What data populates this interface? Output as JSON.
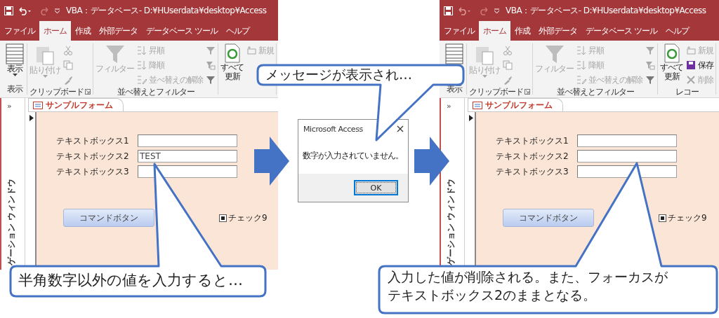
{
  "left_screen": {
    "title": "VBA：データベース- D:¥HUserdata¥desktop¥Access",
    "undo": {
      "disabled": false
    },
    "ribbon_tabs": [
      {
        "label": "ファイル",
        "selected": false
      },
      {
        "label": "ホーム",
        "selected": true
      },
      {
        "label": "作成",
        "selected": false
      },
      {
        "label": "外部データ",
        "selected": false
      },
      {
        "label": "データベース ツール",
        "selected": false
      },
      {
        "label": "ヘルプ",
        "selected": false
      }
    ],
    "ribbon_groups": [
      {
        "kind": "view",
        "label": "表示",
        "items": [
          {
            "label": "表示",
            "disabled": false
          }
        ]
      },
      {
        "kind": "clipboard",
        "label": "クリップボード",
        "items": [
          {
            "label": "貼り付け",
            "disabled": true
          }
        ]
      },
      {
        "kind": "sort",
        "label": "並べ替えとフィルター",
        "items": [
          {
            "label": "フィルター",
            "disabled": true
          },
          {
            "label": "昇順",
            "disabled": true
          },
          {
            "label": "降順",
            "disabled": true
          },
          {
            "label": "並べ替えの解除",
            "disabled": true
          }
        ]
      },
      {
        "kind": "records",
        "items": [
          {
            "lines": [
              "すべて",
              "更新"
            ],
            "disabled": false
          },
          {
            "label": "新規",
            "disabled": true
          }
        ]
      }
    ],
    "nav_pane": {
      "toggle": "»",
      "label": "ゲーション ウィンドウ"
    },
    "form_tab": {
      "label": "サンプルフォーム"
    },
    "form": {
      "fields": [
        {
          "label": "テキストボックス1"
        },
        {
          "label": "テキストボックス2",
          "value": "TEST"
        },
        {
          "label": "テキストボックス3"
        }
      ],
      "command_button": {
        "label": "コマンドボタン"
      },
      "checkbox": {
        "label": "チェック9",
        "checked": true
      }
    }
  },
  "message_dialog": {
    "title": "Microsoft Access",
    "message": "数字が入力されていません。",
    "button": "OK"
  },
  "right_screen": {
    "title": "VBA：データベース- D:¥HUserdata¥desktop¥Access",
    "undo": {
      "disabled": true
    },
    "ribbon_tabs": [
      {
        "label": "ファイル",
        "selected": false
      },
      {
        "label": "ホーム",
        "selected": true
      },
      {
        "label": "作成",
        "selected": false
      },
      {
        "label": "外部データ",
        "selected": false
      },
      {
        "label": "データベース ツール",
        "selected": false
      },
      {
        "label": "ヘルプ",
        "selected": false
      }
    ],
    "ribbon_groups": [
      {
        "kind": "view",
        "label": "表示",
        "items": [
          {
            "disabled": false
          }
        ]
      },
      {
        "kind": "clipboard",
        "label": "クリップボード",
        "items": [
          {
            "label": "貼り付け",
            "disabled": true
          }
        ]
      },
      {
        "kind": "sort",
        "label": "並べ替えとフィルター",
        "items": [
          {
            "label": "フィルター",
            "disabled": true
          },
          {
            "label": "昇順",
            "disabled": true
          },
          {
            "label": "降順",
            "disabled": true
          },
          {
            "label": "並べ替えの解除",
            "disabled": true
          }
        ]
      },
      {
        "kind": "records",
        "label": "レコー",
        "items": [
          {
            "lines": [
              "すべて",
              "更新"
            ],
            "disabled": false
          },
          {
            "label": "新規",
            "disabled": true
          },
          {
            "label": "保存",
            "disabled": false
          },
          {
            "label": "削除",
            "disabled": true
          }
        ]
      }
    ],
    "nav_pane": {
      "toggle": "»",
      "label": "ゲーション ウィンドウ"
    },
    "form_tab": {
      "label": "サンプルフォーム"
    },
    "form": {
      "fields": [
        {
          "label": "テキストボックス1"
        },
        {
          "label": "テキストボックス2"
        },
        {
          "label": "テキストボックス3"
        }
      ],
      "command_button": {
        "label": "コマンドボタン"
      },
      "checkbox": {
        "label": "チェック9",
        "checked": true
      }
    }
  },
  "callouts": [
    {
      "lines": [
        "半角数字以外の値を入力すると…"
      ]
    },
    {
      "lines": [
        "メッセージが表示され…"
      ]
    },
    {
      "lines": [
        "入力した値が削除される。また、フォーカスが",
        "テキストボックス2のままとなる。"
      ]
    }
  ]
}
